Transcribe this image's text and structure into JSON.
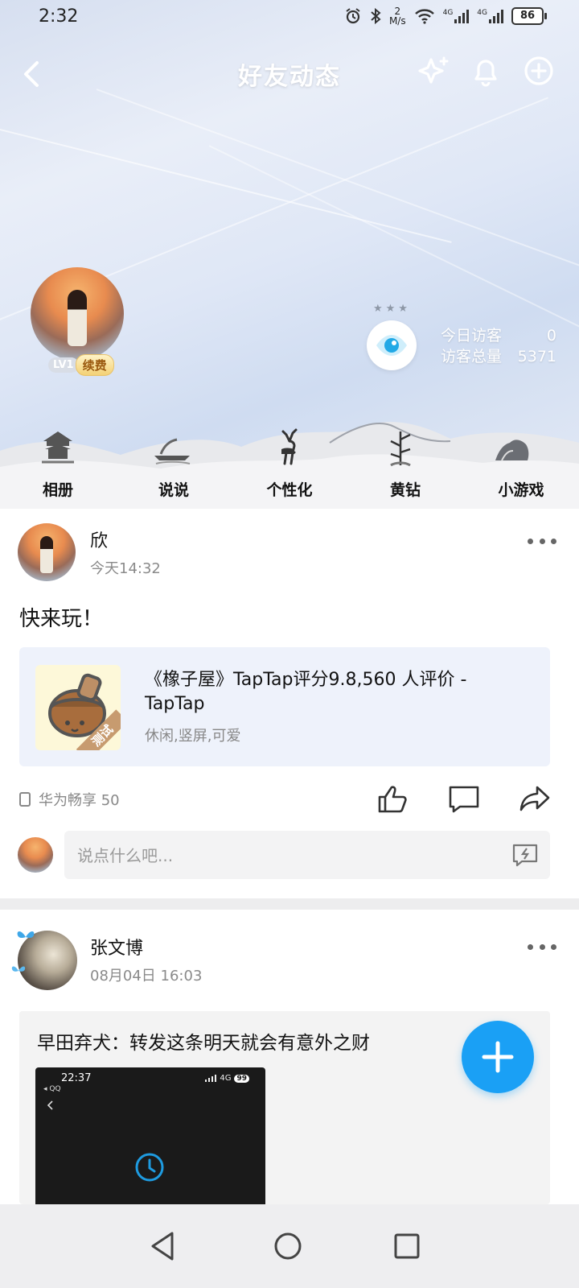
{
  "status_bar": {
    "time": "2:32",
    "net_speed_top": "2",
    "net_speed_unit": "M/s",
    "signal_1": "4G",
    "signal_2": "4G",
    "battery": "86"
  },
  "header": {
    "title": "好友动态",
    "icons": [
      "back-icon",
      "sparkle-icon",
      "bell-icon",
      "add-circle-icon"
    ]
  },
  "profile": {
    "level": "LV1",
    "renew_label": "续费",
    "stars": "★★★",
    "visitors_today_label": "今日访客",
    "visitors_today_value": "0",
    "visitors_total_label": "访客总量",
    "visitors_total_value": "5371"
  },
  "features": [
    {
      "label": "相册",
      "icon": "pavilion-icon"
    },
    {
      "label": "说说",
      "icon": "boat-icon"
    },
    {
      "label": "个性化",
      "icon": "deer-icon"
    },
    {
      "label": "黄钻",
      "icon": "bamboo-icon"
    },
    {
      "label": "小游戏",
      "icon": "rock-icon"
    }
  ],
  "post1": {
    "name": "欣",
    "time": "今天14:32",
    "text": "快来玩！",
    "card": {
      "title": "《橡子屋》TapTap评分9.8,560 人评价 - TapTap",
      "tags": "休闲,竖屏,可爱",
      "thumb_tag": "测试"
    },
    "device": "华为畅享 50",
    "comment_placeholder": "说点什么吧..."
  },
  "post2": {
    "name": "张文博",
    "time": "08月04日 16:03",
    "text": "早田弃犬：转发这条明天就会有意外之财",
    "screenshot": {
      "time": "22:37",
      "app": "◂ QQ",
      "network": "4G",
      "battery": "99"
    }
  },
  "colors": {
    "accent": "#1aa0f5",
    "card_bg": "#eef2fb"
  }
}
